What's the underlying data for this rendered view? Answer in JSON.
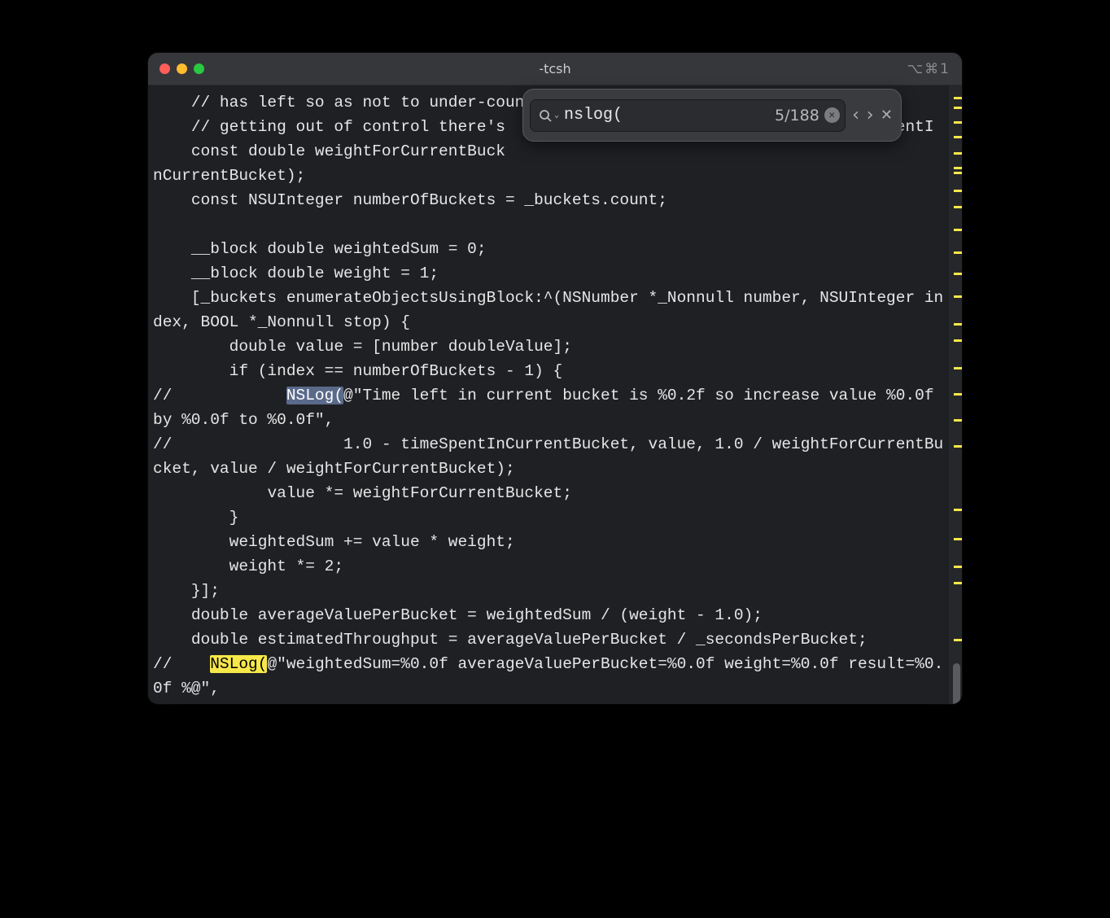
{
  "window": {
    "title": "-tcsh",
    "shortcut": "⌥⌘1"
  },
  "search": {
    "query": "nslog(",
    "count": "5/188"
  },
  "code": {
    "line1": "    // has left so as not to under-count it, but to keep the variance from",
    "line2": "    // getting out of control there's                                         entI",
    "line3_a": "    const double weightForCurrentBuck",
    "line3_b": "nCurrentBucket);",
    "line4": "    const NSUInteger numberOfBuckets = _buckets.count;",
    "blank1": "",
    "line5": "    __block double weightedSum = 0;",
    "line6": "    __block double weight = 1;",
    "line7": "    [_buckets enumerateObjectsUsingBlock:^(NSNumber *_Nonnull number, NSUInteger index, BOOL *_Nonnull stop) {",
    "line8": "        double value = [number doubleValue];",
    "line9": "        if (index == numberOfBuckets - 1) {",
    "line10_a": "//            ",
    "hl1": "NSLog(",
    "line10_b": "@\"Time left in current bucket is %0.2f so increase value %0.0f by %0.0f to %0.0f\",",
    "line11": "//                  1.0 - timeSpentInCurrentBucket, value, 1.0 / weightForCurrentBucket, value / weightForCurrentBucket);",
    "line12": "            value *= weightForCurrentBucket;",
    "line13": "        }",
    "line14": "        weightedSum += value * weight;",
    "line15": "        weight *= 2;",
    "line16": "    }];",
    "line17": "    double averageValuePerBucket = weightedSum / (weight - 1.0);",
    "line18": "    double estimatedThroughput = averageValuePerBucket / _secondsPerBucket;",
    "line19_a": "//    ",
    "hl2": "NSLog(",
    "line19_b": "@\"weightedSum=%0.0f averageValuePerBucket=%0.0f weight=%0.0f result=%0.0f %@\","
  },
  "minimap_marks": [
    14,
    26,
    44,
    62,
    82,
    100,
    106,
    128,
    148,
    176,
    204,
    230,
    258,
    292,
    312,
    346,
    378,
    410,
    442,
    520,
    556,
    590,
    610,
    680
  ]
}
